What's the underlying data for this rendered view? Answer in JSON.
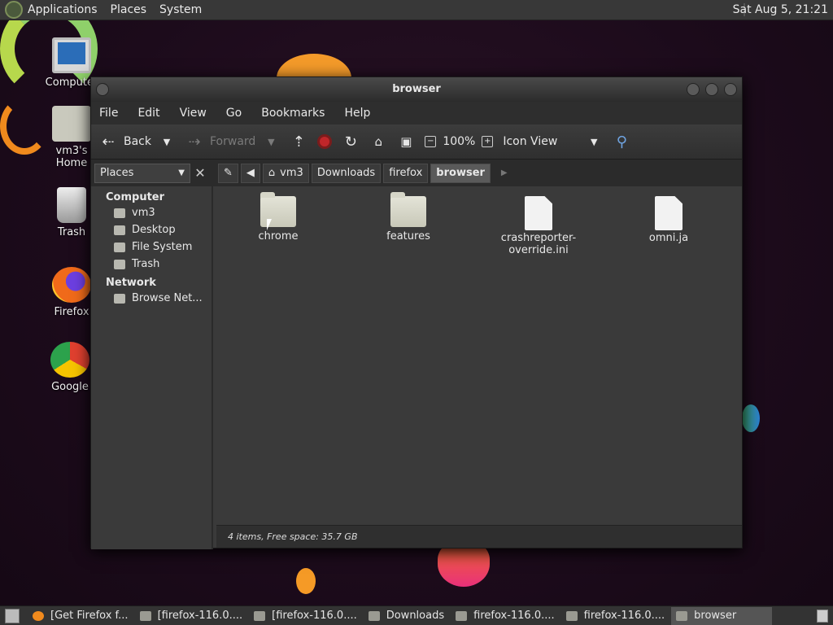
{
  "top_panel": {
    "menus": [
      "Applications",
      "Places",
      "System"
    ],
    "clock": "Sat Aug  5, 21:21"
  },
  "desktop_icons": [
    {
      "label": "Computer",
      "icon": "computer-icon"
    },
    {
      "label": "vm3's Home",
      "icon": "home-folder-icon"
    },
    {
      "label": "Trash",
      "icon": "trash-icon"
    },
    {
      "label": "Firefox",
      "icon": "firefox-icon"
    },
    {
      "label": "Google",
      "icon": "chrome-icon"
    }
  ],
  "window": {
    "title": "browser",
    "menu": [
      "File",
      "Edit",
      "View",
      "Go",
      "Bookmarks",
      "Help"
    ],
    "toolbar": {
      "back": "Back",
      "forward": "Forward",
      "zoom": "100%",
      "view_mode": "Icon View"
    },
    "location": {
      "places_label": "Places",
      "crumbs": [
        "vm3",
        "Downloads",
        "firefox",
        "browser"
      ]
    },
    "sidebar": {
      "sections": [
        {
          "title": "Computer",
          "items": [
            "vm3",
            "Desktop",
            "File System",
            "Trash"
          ]
        },
        {
          "title": "Network",
          "items": [
            "Browse Net..."
          ]
        }
      ]
    },
    "files": [
      {
        "name": "chrome",
        "type": "folder"
      },
      {
        "name": "features",
        "type": "folder"
      },
      {
        "name": "crashreporter-override.ini",
        "name_line1": "crashreporter-",
        "name_line2": "override.ini",
        "type": "file"
      },
      {
        "name": "omni.ja",
        "type": "file"
      }
    ],
    "status": "4 items, Free space: 35.7 GB"
  },
  "taskbar": {
    "tasks": [
      {
        "label": "[Get Firefox f...",
        "icon": "firefox-icon"
      },
      {
        "label": "[firefox-116.0....",
        "icon": "archive-icon"
      },
      {
        "label": "[firefox-116.0....",
        "icon": "folder-icon"
      },
      {
        "label": "Downloads",
        "icon": "folder-icon"
      },
      {
        "label": "firefox-116.0....",
        "icon": "archive-icon"
      },
      {
        "label": "firefox-116.0....",
        "icon": "archive-icon"
      },
      {
        "label": "browser",
        "icon": "folder-icon"
      }
    ]
  },
  "colors": {
    "accent_stop": "#c0262a",
    "desktop_bg": "#1f0f1f"
  }
}
